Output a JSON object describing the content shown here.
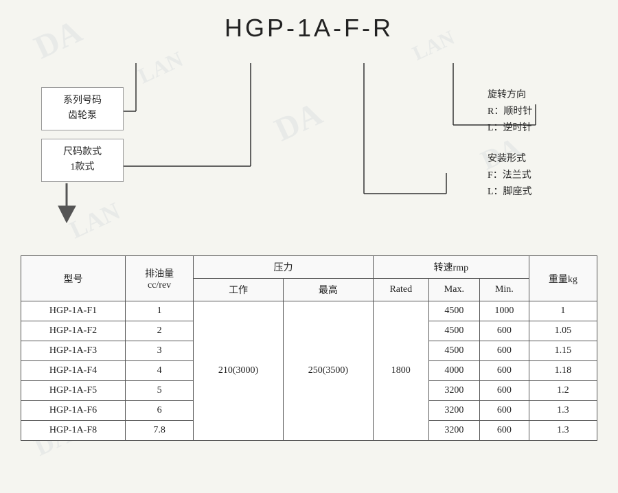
{
  "title": "HGP-1A-F-R",
  "diagram": {
    "label_series": "系列号码\n齿轮泵",
    "label_size": "尺码款式\n1款式",
    "label_rotation": "旋转方向\nR：顺时针\nL：逆时针",
    "label_mount": "安装形式\nF：法兰式\nL：脚座式"
  },
  "table": {
    "col_model": "型号",
    "col_displacement": "排油量\ncc/rev",
    "col_pressure": "压力",
    "col_pressure_work": "工作",
    "col_pressure_max": "最高",
    "col_speed": "转速rmp",
    "col_speed_rated": "Rated",
    "col_speed_max": "Max.",
    "col_speed_min": "Min.",
    "col_weight": "重量kg",
    "rows": [
      {
        "model": "HGP-1A-F1",
        "displacement": "1",
        "pressure_work": "210(3000)",
        "pressure_max": "250(3500)",
        "speed_rated": "1800",
        "speed_max": "4500",
        "speed_min": "1000",
        "weight": "1"
      },
      {
        "model": "HGP-1A-F2",
        "displacement": "2",
        "pressure_work": "",
        "pressure_max": "",
        "speed_rated": "",
        "speed_max": "4500",
        "speed_min": "600",
        "weight": "1.05"
      },
      {
        "model": "HGP-1A-F3",
        "displacement": "3",
        "pressure_work": "",
        "pressure_max": "",
        "speed_rated": "",
        "speed_max": "4500",
        "speed_min": "600",
        "weight": "1.15"
      },
      {
        "model": "HGP-1A-F4",
        "displacement": "4",
        "pressure_work": "",
        "pressure_max": "",
        "speed_rated": "",
        "speed_max": "4000",
        "speed_min": "600",
        "weight": "1.18"
      },
      {
        "model": "HGP-1A-F5",
        "displacement": "5",
        "pressure_work": "",
        "pressure_max": "",
        "speed_rated": "",
        "speed_max": "3200",
        "speed_min": "600",
        "weight": "1.2"
      },
      {
        "model": "HGP-1A-F6",
        "displacement": "6",
        "pressure_work": "",
        "pressure_max": "",
        "speed_rated": "",
        "speed_max": "3200",
        "speed_min": "600",
        "weight": "1.3"
      },
      {
        "model": "HGP-1A-F8",
        "displacement": "7.8",
        "pressure_work": "",
        "pressure_max": "",
        "speed_rated": "",
        "speed_max": "3200",
        "speed_min": "600",
        "weight": "1.3"
      }
    ],
    "merged_pressure_work": "210(3000)",
    "merged_pressure_max": "250(3500)",
    "merged_speed_rated": "1800"
  }
}
